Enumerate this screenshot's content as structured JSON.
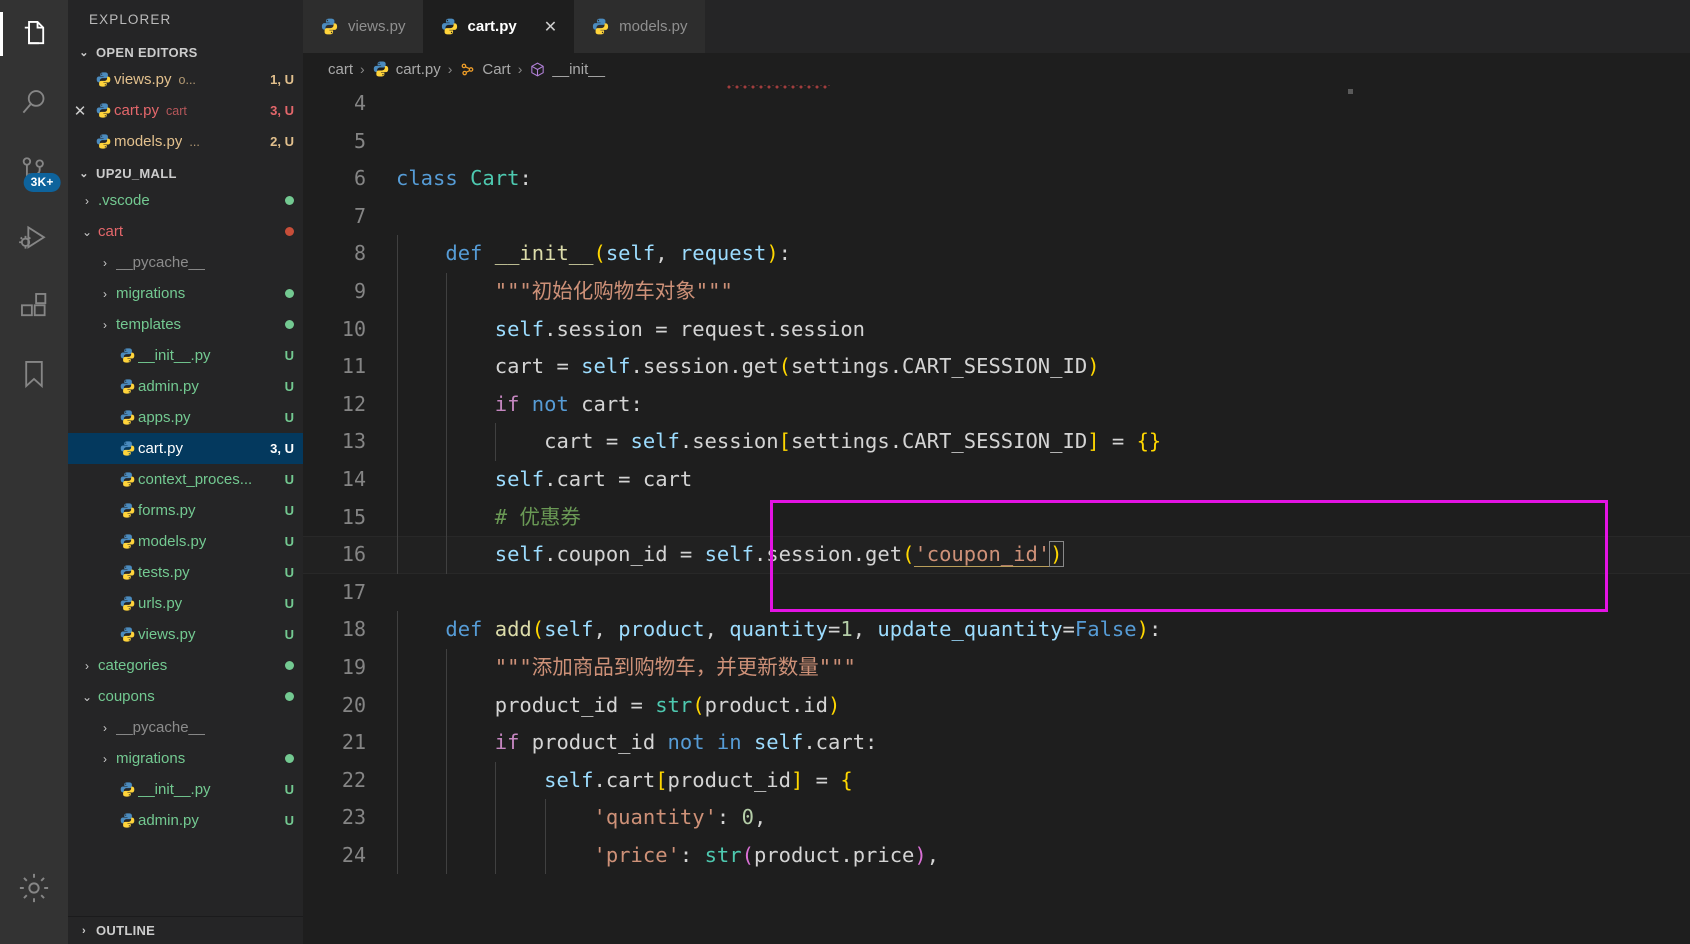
{
  "app": {
    "name": "Visual Studio Code"
  },
  "activitybar": {
    "items": [
      {
        "name": "explorer",
        "icon": "files-icon",
        "active": true
      },
      {
        "name": "search",
        "icon": "search-icon",
        "active": false
      },
      {
        "name": "source-control",
        "icon": "source-control-icon",
        "active": false,
        "badge": "3K+"
      },
      {
        "name": "run-debug",
        "icon": "run-and-debug-icon",
        "active": false
      },
      {
        "name": "extensions",
        "icon": "extensions-icon",
        "active": false
      },
      {
        "name": "bookmarks",
        "icon": "bookmark-icon",
        "active": false
      }
    ],
    "bottom": {
      "name": "manage",
      "icon": "gear-icon"
    },
    "badge_color": "#0e639c"
  },
  "sidebar": {
    "title": "EXPLORER",
    "open_editors": {
      "label": "OPEN EDITORS",
      "twisty": "⌄",
      "items": [
        {
          "name": "views.py",
          "desc": "o...",
          "badge": "1, U",
          "color": "#e2c08d",
          "close": false
        },
        {
          "name": "cart.py",
          "desc": "cart",
          "badge": "3, U",
          "color": "#e4676b",
          "close": true
        },
        {
          "name": "models.py",
          "desc": "...",
          "badge": "2, U",
          "color": "#e2c08d",
          "close": false
        }
      ]
    },
    "project": {
      "label": "UP2U_MALL",
      "twisty": "⌄"
    },
    "tree": [
      {
        "label": ".vscode",
        "depth": 1,
        "kind": "folder",
        "expanded": false,
        "color": "#73c991",
        "dot": "green"
      },
      {
        "label": "cart",
        "depth": 1,
        "kind": "folder",
        "expanded": true,
        "color": "#e4676b",
        "dot": "red"
      },
      {
        "label": "__pycache__",
        "depth": 2,
        "kind": "folder",
        "expanded": false,
        "color": "#8c8c8c",
        "dot": ""
      },
      {
        "label": "migrations",
        "depth": 2,
        "kind": "folder",
        "expanded": false,
        "color": "#73c991",
        "dot": "green"
      },
      {
        "label": "templates",
        "depth": 2,
        "kind": "folder",
        "expanded": false,
        "color": "#73c991",
        "dot": "green"
      },
      {
        "label": "__init__.py",
        "depth": 2,
        "kind": "file",
        "color": "#73c991",
        "badge": "U"
      },
      {
        "label": "admin.py",
        "depth": 2,
        "kind": "file",
        "color": "#73c991",
        "badge": "U"
      },
      {
        "label": "apps.py",
        "depth": 2,
        "kind": "file",
        "color": "#73c991",
        "badge": "U"
      },
      {
        "label": "cart.py",
        "depth": 2,
        "kind": "file",
        "color": "#ffffff",
        "badge": "3, U",
        "selected": true
      },
      {
        "label": "context_proces...",
        "depth": 2,
        "kind": "file",
        "color": "#73c991",
        "badge": "U"
      },
      {
        "label": "forms.py",
        "depth": 2,
        "kind": "file",
        "color": "#73c991",
        "badge": "U"
      },
      {
        "label": "models.py",
        "depth": 2,
        "kind": "file",
        "color": "#73c991",
        "badge": "U"
      },
      {
        "label": "tests.py",
        "depth": 2,
        "kind": "file",
        "color": "#73c991",
        "badge": "U"
      },
      {
        "label": "urls.py",
        "depth": 2,
        "kind": "file",
        "color": "#73c991",
        "badge": "U"
      },
      {
        "label": "views.py",
        "depth": 2,
        "kind": "file",
        "color": "#73c991",
        "badge": "U"
      },
      {
        "label": "categories",
        "depth": 1,
        "kind": "folder",
        "expanded": false,
        "color": "#73c991",
        "dot": "green"
      },
      {
        "label": "coupons",
        "depth": 1,
        "kind": "folder",
        "expanded": true,
        "color": "#73c991",
        "dot": "green"
      },
      {
        "label": "__pycache__",
        "depth": 2,
        "kind": "folder",
        "expanded": false,
        "color": "#8c8c8c",
        "dot": ""
      },
      {
        "label": "migrations",
        "depth": 2,
        "kind": "folder",
        "expanded": false,
        "color": "#73c991",
        "dot": "green"
      },
      {
        "label": "__init__.py",
        "depth": 2,
        "kind": "file",
        "color": "#73c991",
        "badge": "U"
      },
      {
        "label": "admin.py",
        "depth": 2,
        "kind": "file",
        "color": "#73c991",
        "badge": "U"
      }
    ],
    "outline": {
      "label": "OUTLINE",
      "twisty": "›"
    }
  },
  "tabs": [
    {
      "label": "views.py",
      "active": false,
      "closable": false
    },
    {
      "label": "cart.py",
      "active": true,
      "closable": true,
      "close_glyph": "✕"
    },
    {
      "label": "models.py",
      "active": false,
      "closable": false
    }
  ],
  "breadcrumbs": {
    "separator": "›",
    "items": [
      {
        "label": "cart",
        "icon": ""
      },
      {
        "label": "cart.py",
        "icon": "python-icon"
      },
      {
        "label": "Cart",
        "icon": "class-icon"
      },
      {
        "label": "__init__",
        "icon": "method-icon"
      }
    ]
  },
  "editor": {
    "language": "python",
    "first_visible_line": 4,
    "current_line": 16,
    "highlight_box": {
      "color": "#e413e4",
      "from_line": 15,
      "to_line": 17
    },
    "lines": [
      {
        "n": 4,
        "tokens": []
      },
      {
        "n": 5,
        "tokens": []
      },
      {
        "n": 6,
        "tokens": [
          {
            "t": "class",
            "c": "t-kw"
          },
          {
            "t": " ",
            "c": "t-plain"
          },
          {
            "t": "Cart",
            "c": "t-type"
          },
          {
            "t": ":",
            "c": "t-plain"
          }
        ]
      },
      {
        "n": 7,
        "tokens": []
      },
      {
        "n": 8,
        "tokens": [
          {
            "t": "    ",
            "c": "t-plain"
          },
          {
            "t": "def",
            "c": "t-kw"
          },
          {
            "t": " ",
            "c": "t-plain"
          },
          {
            "t": "__init__",
            "c": "t-fn"
          },
          {
            "t": "(",
            "c": "t-br1"
          },
          {
            "t": "self",
            "c": "t-var"
          },
          {
            "t": ", ",
            "c": "t-plain"
          },
          {
            "t": "request",
            "c": "t-var"
          },
          {
            "t": ")",
            "c": "t-br1"
          },
          {
            "t": ":",
            "c": "t-plain"
          }
        ]
      },
      {
        "n": 9,
        "tokens": [
          {
            "t": "        ",
            "c": "t-plain"
          },
          {
            "t": "\"\"\"初始化购物车对象\"\"\"",
            "c": "t-doc"
          }
        ]
      },
      {
        "n": 10,
        "tokens": [
          {
            "t": "        ",
            "c": "t-plain"
          },
          {
            "t": "self",
            "c": "t-var"
          },
          {
            "t": ".session = request.session",
            "c": "t-plain"
          }
        ]
      },
      {
        "n": 11,
        "tokens": [
          {
            "t": "        cart = ",
            "c": "t-plain"
          },
          {
            "t": "self",
            "c": "t-var"
          },
          {
            "t": ".session.get",
            "c": "t-plain"
          },
          {
            "t": "(",
            "c": "t-br1"
          },
          {
            "t": "settings.CART_SESSION_ID",
            "c": "t-plain"
          },
          {
            "t": ")",
            "c": "t-br1"
          }
        ]
      },
      {
        "n": 12,
        "tokens": [
          {
            "t": "        ",
            "c": "t-plain"
          },
          {
            "t": "if",
            "c": "t-kw2"
          },
          {
            "t": " ",
            "c": "t-plain"
          },
          {
            "t": "not",
            "c": "t-kw"
          },
          {
            "t": " cart:",
            "c": "t-plain"
          }
        ]
      },
      {
        "n": 13,
        "tokens": [
          {
            "t": "            cart = ",
            "c": "t-plain"
          },
          {
            "t": "self",
            "c": "t-var"
          },
          {
            "t": ".session",
            "c": "t-plain"
          },
          {
            "t": "[",
            "c": "t-br1"
          },
          {
            "t": "settings.CART_SESSION_ID",
            "c": "t-plain"
          },
          {
            "t": "]",
            "c": "t-br1"
          },
          {
            "t": " = ",
            "c": "t-plain"
          },
          {
            "t": "{}",
            "c": "t-br1"
          }
        ]
      },
      {
        "n": 14,
        "tokens": [
          {
            "t": "        ",
            "c": "t-plain"
          },
          {
            "t": "self",
            "c": "t-var"
          },
          {
            "t": ".cart = cart",
            "c": "t-plain"
          }
        ]
      },
      {
        "n": 15,
        "tokens": [
          {
            "t": "        ",
            "c": "t-plain"
          },
          {
            "t": "# 优惠券",
            "c": "t-cmt"
          }
        ]
      },
      {
        "n": 16,
        "tokens": [
          {
            "t": "        ",
            "c": "t-plain"
          },
          {
            "t": "self",
            "c": "t-var"
          },
          {
            "t": ".coupon_id = ",
            "c": "t-plain"
          },
          {
            "t": "self",
            "c": "t-var"
          },
          {
            "t": ".session.get",
            "c": "t-plain"
          },
          {
            "t": "(",
            "c": "t-br1"
          },
          {
            "t": "'coupon_id'",
            "c": "t-str"
          },
          {
            "t": ")",
            "c": "t-br1"
          }
        ]
      },
      {
        "n": 17,
        "tokens": []
      },
      {
        "n": 18,
        "tokens": [
          {
            "t": "    ",
            "c": "t-plain"
          },
          {
            "t": "def",
            "c": "t-kw"
          },
          {
            "t": " ",
            "c": "t-plain"
          },
          {
            "t": "add",
            "c": "t-fn"
          },
          {
            "t": "(",
            "c": "t-br1"
          },
          {
            "t": "self",
            "c": "t-var"
          },
          {
            "t": ", ",
            "c": "t-plain"
          },
          {
            "t": "product",
            "c": "t-var"
          },
          {
            "t": ", ",
            "c": "t-plain"
          },
          {
            "t": "quantity",
            "c": "t-var"
          },
          {
            "t": "=",
            "c": "t-plain"
          },
          {
            "t": "1",
            "c": "t-num"
          },
          {
            "t": ", ",
            "c": "t-plain"
          },
          {
            "t": "update_quantity",
            "c": "t-var"
          },
          {
            "t": "=",
            "c": "t-plain"
          },
          {
            "t": "False",
            "c": "t-kw"
          },
          {
            "t": ")",
            "c": "t-br1"
          },
          {
            "t": ":",
            "c": "t-plain"
          }
        ]
      },
      {
        "n": 19,
        "tokens": [
          {
            "t": "        ",
            "c": "t-plain"
          },
          {
            "t": "\"\"\"添加商品到购物车，并更新数量\"\"\"",
            "c": "t-doc"
          }
        ]
      },
      {
        "n": 20,
        "tokens": [
          {
            "t": "        product_id = ",
            "c": "t-plain"
          },
          {
            "t": "str",
            "c": "t-type"
          },
          {
            "t": "(",
            "c": "t-br1"
          },
          {
            "t": "product.id",
            "c": "t-plain"
          },
          {
            "t": ")",
            "c": "t-br1"
          }
        ]
      },
      {
        "n": 21,
        "tokens": [
          {
            "t": "        ",
            "c": "t-plain"
          },
          {
            "t": "if",
            "c": "t-kw2"
          },
          {
            "t": " product_id ",
            "c": "t-plain"
          },
          {
            "t": "not",
            "c": "t-kw"
          },
          {
            "t": " ",
            "c": "t-plain"
          },
          {
            "t": "in",
            "c": "t-kw"
          },
          {
            "t": " ",
            "c": "t-plain"
          },
          {
            "t": "self",
            "c": "t-var"
          },
          {
            "t": ".cart:",
            "c": "t-plain"
          }
        ]
      },
      {
        "n": 22,
        "tokens": [
          {
            "t": "            ",
            "c": "t-plain"
          },
          {
            "t": "self",
            "c": "t-var"
          },
          {
            "t": ".cart",
            "c": "t-plain"
          },
          {
            "t": "[",
            "c": "t-br1"
          },
          {
            "t": "product_id",
            "c": "t-plain"
          },
          {
            "t": "]",
            "c": "t-br1"
          },
          {
            "t": " = ",
            "c": "t-plain"
          },
          {
            "t": "{",
            "c": "t-br1"
          }
        ]
      },
      {
        "n": 23,
        "tokens": [
          {
            "t": "                ",
            "c": "t-plain"
          },
          {
            "t": "'quantity'",
            "c": "t-str"
          },
          {
            "t": ": ",
            "c": "t-plain"
          },
          {
            "t": "0",
            "c": "t-num"
          },
          {
            "t": ",",
            "c": "t-plain"
          }
        ]
      },
      {
        "n": 24,
        "tokens": [
          {
            "t": "                ",
            "c": "t-plain"
          },
          {
            "t": "'price'",
            "c": "t-str"
          },
          {
            "t": ": ",
            "c": "t-plain"
          },
          {
            "t": "str",
            "c": "t-type"
          },
          {
            "t": "(",
            "c": "t-br2"
          },
          {
            "t": "product.price",
            "c": "t-plain"
          },
          {
            "t": ")",
            "c": "t-br2"
          },
          {
            "t": ",",
            "c": "t-plain"
          }
        ]
      }
    ]
  },
  "colors": {
    "activitybar_bg": "#333333",
    "sidebar_bg": "#252526",
    "editor_bg": "#1e1e1e",
    "tab_inactive_bg": "#2d2d2d",
    "selection_blue": "#04395e",
    "highlight_magenta": "#e413e4"
  }
}
